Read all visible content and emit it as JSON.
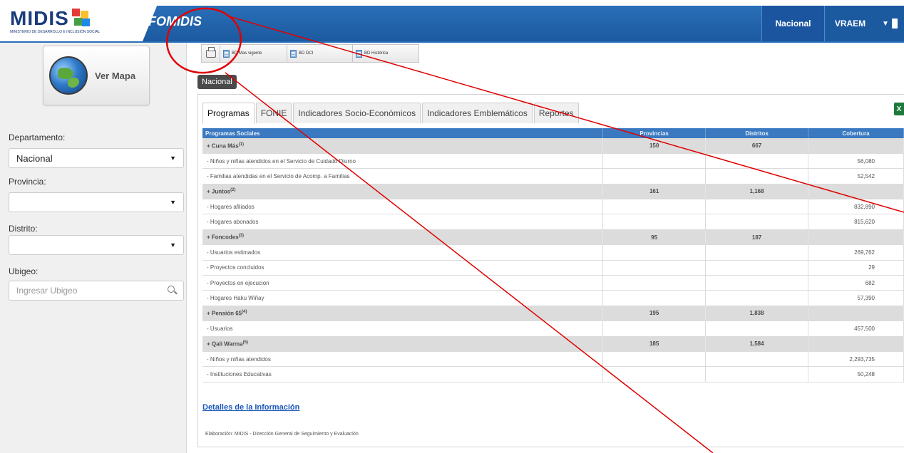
{
  "header": {
    "logo_text": "MIDIS",
    "logo_subtitle": "MINISTERIO DE DESARROLLO E INCLUSIÓN SOCIAL",
    "app_title": "INFOMIDIS",
    "nav": {
      "nacional": "Nacional",
      "vraem": "VRAEM"
    },
    "colors": {
      "bar": "#1c5aa0",
      "logo_mark": [
        "#e53935",
        "#fbc02d",
        "#43a047",
        "#1e88e5"
      ]
    }
  },
  "sidebar": {
    "map_button": "Ver Mapa",
    "departamento": {
      "label": "Departamento:",
      "value": "Nacional"
    },
    "provincia": {
      "label": "Provincia:",
      "value": ""
    },
    "distrito": {
      "label": "Distrito:",
      "value": ""
    },
    "ubigeo": {
      "label": "Ubigeo:",
      "placeholder": "Ingresar Ubigeo"
    }
  },
  "toolbar": {
    "bd_mas_vigente": "BD Mas vigente",
    "bd_dci": "BD DCI",
    "bd_historica": "BD Histórica"
  },
  "scope_badge": "Nacional",
  "tabs": [
    "Programas",
    "FONIE",
    "Indicadores Socio-Económicos",
    "Indicadores Emblemáticos",
    "Reportes"
  ],
  "table": {
    "headers": [
      "Programas Sociales",
      "Provincias",
      "Distritos",
      "Cobertura"
    ],
    "rows": [
      {
        "type": "group",
        "name": "+ Cuna Más",
        "sup": "(1)",
        "provincias": "150",
        "distritos": "667",
        "cobertura": ""
      },
      {
        "type": "item",
        "name": "- Niños y niñas atendidos en el Servicio de Cuidado Diurno",
        "provincias": "",
        "distritos": "",
        "cobertura": "56,080"
      },
      {
        "type": "item",
        "name": "- Familias atendidas en el Servicio de Acomp. a Familias",
        "provincias": "",
        "distritos": "",
        "cobertura": "52,542"
      },
      {
        "type": "group",
        "name": "+ Juntos",
        "sup": "(2)",
        "provincias": "161",
        "distritos": "1,168",
        "cobertura": ""
      },
      {
        "type": "item",
        "name": "- Hogares afiliados",
        "provincias": "",
        "distritos": "",
        "cobertura": "832,890"
      },
      {
        "type": "item",
        "name": "- Hogares abonados",
        "provincias": "",
        "distritos": "",
        "cobertura": "815,620"
      },
      {
        "type": "group",
        "name": "+ Foncodes",
        "sup": "(3)",
        "provincias": "95",
        "distritos": "187",
        "cobertura": ""
      },
      {
        "type": "item",
        "name": "- Usuarios estimados",
        "provincias": "",
        "distritos": "",
        "cobertura": "269,762"
      },
      {
        "type": "item",
        "name": "- Proyectos concluidos",
        "provincias": "",
        "distritos": "",
        "cobertura": "29"
      },
      {
        "type": "item",
        "name": "- Proyectos en ejecucion",
        "provincias": "",
        "distritos": "",
        "cobertura": "682"
      },
      {
        "type": "item",
        "name": "- Hogares Haku Wiñay",
        "provincias": "",
        "distritos": "",
        "cobertura": "57,390"
      },
      {
        "type": "group",
        "name": "+ Pensión 65",
        "sup": "(4)",
        "provincias": "195",
        "distritos": "1,838",
        "cobertura": ""
      },
      {
        "type": "item",
        "name": "- Usuarios",
        "provincias": "",
        "distritos": "",
        "cobertura": "457,500"
      },
      {
        "type": "group",
        "name": "+ Qali Warma",
        "sup": "(5)",
        "provincias": "185",
        "distritos": "1,584",
        "cobertura": ""
      },
      {
        "type": "item",
        "name": "- Niños y niñas atendidos",
        "provincias": "",
        "distritos": "",
        "cobertura": "2,293,735"
      },
      {
        "type": "item",
        "name": "- Instituciones Educativas",
        "provincias": "",
        "distritos": "",
        "cobertura": "50,248"
      }
    ]
  },
  "details_link": "Detalles de la Información",
  "footnote": "Elaboración: MIDIS - Dirección General de Seguimiento y Evaluación",
  "annotation_color": "#e00000"
}
